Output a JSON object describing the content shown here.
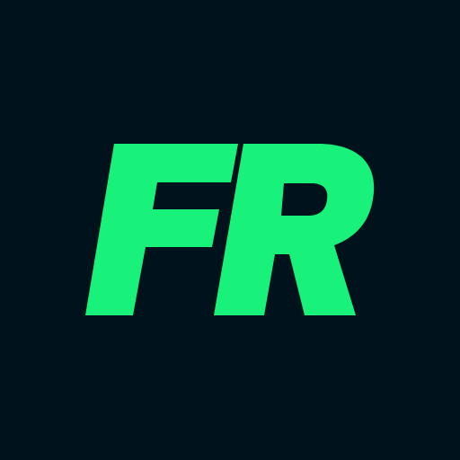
{
  "logo": {
    "text": "FR",
    "background_color": "#00131c",
    "text_color": "#19f27a"
  }
}
